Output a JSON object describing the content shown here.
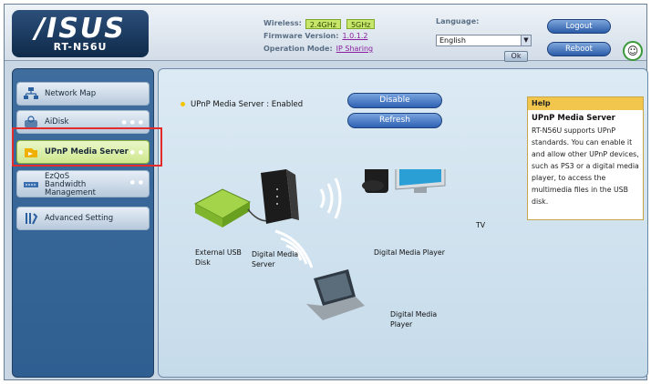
{
  "header": {
    "logo": "/ISUS",
    "model": "RT-N56U",
    "wireless_label": "Wireless:",
    "band_24": "2.4GHz",
    "band_5": "5GHz",
    "firmware_label": "Firmware Version:",
    "firmware_value": "1.0.1.2",
    "opmode_label": "Operation Mode:",
    "opmode_value": "IP Sharing",
    "language_label": "Language:",
    "language_value": "English",
    "ok_label": "Ok",
    "logout_label": "Logout",
    "reboot_label": "Reboot"
  },
  "sidebar": {
    "items": [
      {
        "label": "Network Map",
        "icon": "network-map-icon"
      },
      {
        "label": "AiDisk",
        "icon": "disk-icon"
      },
      {
        "label": "UPnP Media Server",
        "icon": "media-server-icon"
      },
      {
        "label": "EzQoS\nBandwidth\nManagement",
        "icon": "qos-icon"
      },
      {
        "label": "Advanced Setting",
        "icon": "tools-icon"
      }
    ]
  },
  "main": {
    "status_text": "UPnP Media Server : Enabled",
    "disable_label": "Disable",
    "refresh_label": "Refresh",
    "captions": {
      "usb": "External USB\nDisk",
      "server": "Digital Media\nServer",
      "player": "Digital Media Player",
      "tv": "TV",
      "laptop": "Digital Media\nPlayer"
    }
  },
  "help": {
    "header": "Help",
    "title": "UPnP Media Server",
    "body": "RT-N56U supports UPnP standards. You can enable it and allow other UPnP devices, such as PS3 or a digital media player, to access the multimedia files in the USB disk."
  },
  "colors": {
    "accent": "#2f62b3",
    "active_menu": "#cfe78d",
    "highlight": "#e32b2b",
    "help_header": "#f2c64c"
  }
}
